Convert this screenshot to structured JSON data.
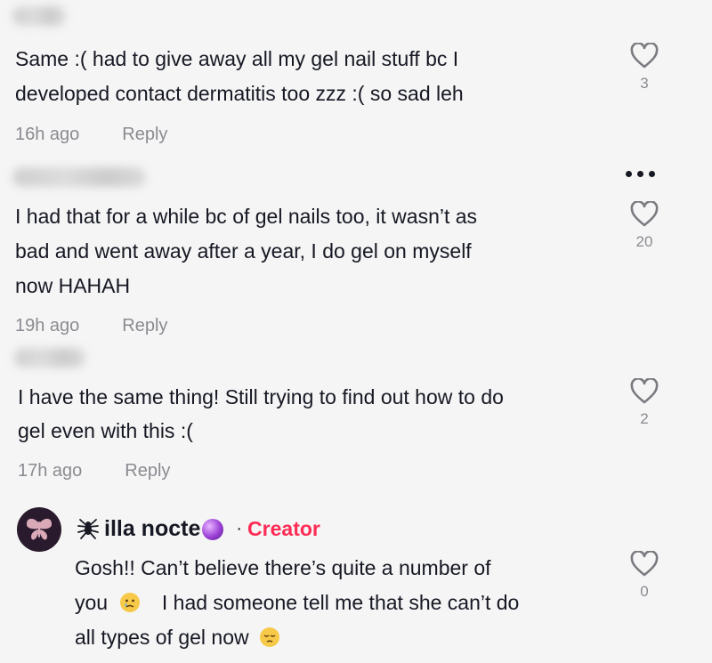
{
  "comments": [
    {
      "text_lines": [
        "Same :( had to give away all my gel nail stuff bc I",
        "developed contact dermatitis too zzz :( so sad leh"
      ],
      "time": "16h ago",
      "reply": "Reply",
      "likes": "3"
    },
    {
      "text_lines": [
        "I had that for a while bc of gel nails too, it wasn’t as",
        "bad and went away after a year, I do gel on myself",
        "now HAHAH"
      ],
      "time": "19h ago",
      "reply": "Reply",
      "likes": "20"
    },
    {
      "text_lines": [
        "I have the same thing! Still trying to find out how to do",
        "gel even with this :("
      ],
      "time": "17h ago",
      "reply": "Reply",
      "likes": "2"
    }
  ],
  "creator_comment": {
    "username": "illa nocte",
    "separator": "·",
    "badge": "Creator",
    "line1": "Gosh!! Can’t believe there’s quite a number of",
    "line2_a": "you",
    "line2_b": "I had someone tell me that she can’t do",
    "line3_a": "all types of gel now",
    "likes": "0"
  },
  "colors": {
    "accent_creator": "#fe2c55",
    "text_primary": "#161823",
    "text_secondary": "#8a8b91"
  },
  "icons": [
    "heart-outline-icon",
    "more-dots-icon",
    "spider-icon",
    "crystal-ball-icon",
    "crying-face-icon",
    "pensive-face-icon",
    "moth-avatar"
  ]
}
